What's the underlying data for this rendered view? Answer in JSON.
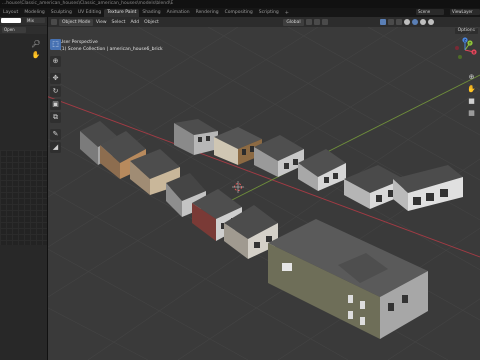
{
  "window": {
    "title": "...house\\Classic_american_houses\\Classic_american_houses\\models\\blend\\E"
  },
  "workspace_tabs": [
    {
      "label": "Layout",
      "active": false
    },
    {
      "label": "Modeling",
      "active": false
    },
    {
      "label": "Sculpting",
      "active": false
    },
    {
      "label": "UV Editing",
      "active": false
    },
    {
      "label": "Texture Paint",
      "active": true
    },
    {
      "label": "Shading",
      "active": false
    },
    {
      "label": "Animation",
      "active": false
    },
    {
      "label": "Rendering",
      "active": false
    },
    {
      "label": "Compositing",
      "active": false
    },
    {
      "label": "Scripting",
      "active": false
    }
  ],
  "workspace_add": "+",
  "scene_field": "Scene",
  "view_layer_field": "ViewLayer",
  "left_panel": {
    "mix_value": "Mix",
    "open_label": "Open"
  },
  "viewport_header": {
    "mode": "Object Mode",
    "menus": [
      "View",
      "Select",
      "Add",
      "Object"
    ],
    "orientation": "Global",
    "options": "Options"
  },
  "view_info": {
    "line1": "User Perspective",
    "line2": "(1) Scene Collection | american_house6_brick"
  },
  "tools": [
    "select-box",
    "cursor",
    "move",
    "rotate",
    "scale",
    "transform",
    "annotate",
    "measure"
  ],
  "nav": {
    "x_label": "X",
    "y_label": "Y",
    "z_label": "Z"
  },
  "colors": {
    "accent": "#4772b3",
    "x_axis": "#e0475b",
    "y_axis": "#8fc43b",
    "z_axis": "#4a86e0",
    "grid": "#444444",
    "background": "#3a3a3a"
  }
}
